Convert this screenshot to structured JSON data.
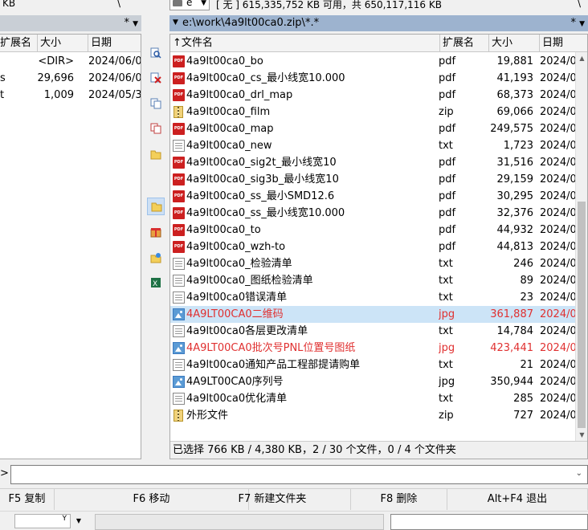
{
  "left_top": {
    "size_frag": "KB",
    "slash": "\\",
    "filter": "*",
    "filter_arrow": "▼"
  },
  "right_top": {
    "drive_letter": "e",
    "drive_arrow": "▼",
    "free_info": "[ 无 ]  615,335,752 KB 可用，共 650,117,116 KB",
    "slash": "\\",
    "path_arrow": "▼",
    "path": "e:\\work\\4a9lt00ca0.zip\\*.*",
    "filter": "*",
    "filter_arrow": "▼"
  },
  "left_panel": {
    "headers": {
      "ext": "扩展名",
      "size": "大小",
      "date": "日期"
    },
    "rows": [
      {
        "name": "",
        "ext": "",
        "size": "<DIR>",
        "date": "2024/06/0"
      },
      {
        "name": "s",
        "ext": "",
        "size": "29,696",
        "date": "2024/06/0"
      },
      {
        "name": "t",
        "ext": "",
        "size": "1,009",
        "date": "2024/05/3"
      }
    ]
  },
  "right_panel": {
    "headers": {
      "name": "↑文件名",
      "ext": "扩展名",
      "size": "大小",
      "date": "日期"
    },
    "rows": [
      {
        "icon": "pdf",
        "name": "4a9lt00ca0_bo",
        "ext": "pdf",
        "size": "19,881",
        "date": "2024/0",
        "red": false,
        "selected": false
      },
      {
        "icon": "pdf",
        "name": "4a9lt00ca0_cs_最小线宽10.000",
        "ext": "pdf",
        "size": "41,193",
        "date": "2024/0",
        "red": false,
        "selected": false
      },
      {
        "icon": "pdf",
        "name": "4a9lt00ca0_drl_map",
        "ext": "pdf",
        "size": "68,373",
        "date": "2024/0",
        "red": false,
        "selected": false
      },
      {
        "icon": "zip",
        "name": "4a9lt00ca0_film",
        "ext": "zip",
        "size": "69,066",
        "date": "2024/0",
        "red": false,
        "selected": false
      },
      {
        "icon": "pdf",
        "name": "4a9lt00ca0_map",
        "ext": "pdf",
        "size": "249,575",
        "date": "2024/0",
        "red": false,
        "selected": false
      },
      {
        "icon": "txt",
        "name": "4a9lt00ca0_new",
        "ext": "txt",
        "size": "1,723",
        "date": "2024/0",
        "red": false,
        "selected": false
      },
      {
        "icon": "pdf",
        "name": "4a9lt00ca0_sig2t_最小线宽10",
        "ext": "pdf",
        "size": "31,516",
        "date": "2024/0",
        "red": false,
        "selected": false
      },
      {
        "icon": "pdf",
        "name": "4a9lt00ca0_sig3b_最小线宽10",
        "ext": "pdf",
        "size": "29,159",
        "date": "2024/0",
        "red": false,
        "selected": false
      },
      {
        "icon": "pdf",
        "name": "4a9lt00ca0_ss_最小SMD12.6",
        "ext": "pdf",
        "size": "30,295",
        "date": "2024/0",
        "red": false,
        "selected": false
      },
      {
        "icon": "pdf",
        "name": "4a9lt00ca0_ss_最小线宽10.000",
        "ext": "pdf",
        "size": "32,376",
        "date": "2024/0",
        "red": false,
        "selected": false
      },
      {
        "icon": "pdf",
        "name": "4a9lt00ca0_to",
        "ext": "pdf",
        "size": "44,932",
        "date": "2024/0",
        "red": false,
        "selected": false
      },
      {
        "icon": "pdf",
        "name": "4a9lt00ca0_wzh-to",
        "ext": "pdf",
        "size": "44,813",
        "date": "2024/0",
        "red": false,
        "selected": false
      },
      {
        "icon": "txt",
        "name": "4a9lt00ca0_检验清单",
        "ext": "txt",
        "size": "246",
        "date": "2024/0",
        "red": false,
        "selected": false
      },
      {
        "icon": "txt",
        "name": "4a9lt00ca0_图纸检验清单",
        "ext": "txt",
        "size": "89",
        "date": "2024/0",
        "red": false,
        "selected": false
      },
      {
        "icon": "txt",
        "name": "4a9lt00ca0错误清单",
        "ext": "txt",
        "size": "23",
        "date": "2024/0",
        "red": false,
        "selected": false
      },
      {
        "icon": "jpg",
        "name": "4A9LT00CA0二维码",
        "ext": "jpg",
        "size": "361,887",
        "date": "2024/0",
        "red": true,
        "selected": true
      },
      {
        "icon": "txt",
        "name": "4a9lt00ca0各层更改清单",
        "ext": "txt",
        "size": "14,784",
        "date": "2024/0",
        "red": false,
        "selected": false
      },
      {
        "icon": "jpg",
        "name": "4A9LT00CA0批次号PNL位置号图纸",
        "ext": "jpg",
        "size": "423,441",
        "date": "2024/0",
        "red": true,
        "selected": false
      },
      {
        "icon": "txt",
        "name": "4a9lt00ca0通知产品工程部提请购单",
        "ext": "txt",
        "size": "21",
        "date": "2024/0",
        "red": false,
        "selected": false
      },
      {
        "icon": "jpg",
        "name": "4A9LT00CA0序列号",
        "ext": "jpg",
        "size": "350,944",
        "date": "2024/0",
        "red": false,
        "selected": false
      },
      {
        "icon": "txt",
        "name": "4a9lt00ca0优化清单",
        "ext": "txt",
        "size": "285",
        "date": "2024/0",
        "red": false,
        "selected": false
      },
      {
        "icon": "zip",
        "name": "外形文件",
        "ext": "zip",
        "size": "727",
        "date": "2024/0",
        "red": false,
        "selected": false
      }
    ],
    "status": "已选择 766 KB / 4,380 KB，2 / 30 个文件，0 / 4 个文件夹"
  },
  "toolbar_icons": [
    "find-icon",
    "delete-icon",
    "copy-icon",
    "move-icon",
    "folder-icon",
    "folder-icon",
    "pack-icon",
    "new-folder-icon",
    "excel-icon"
  ],
  "command": {
    "prompt": ">",
    "arrow": "⌄"
  },
  "fkeys": [
    {
      "label": "F5 复制"
    },
    {
      "label": "F6 移动"
    },
    {
      "label": "F7 新建文件夹"
    },
    {
      "label": "F8 删除"
    },
    {
      "label": "Alt+F4 退出"
    }
  ],
  "bottom": {
    "seg_text": "Y",
    "seg_arrow": "▼"
  },
  "colors": {
    "selected_bg": "#cce4f7",
    "red_text": "#e03030",
    "path_active_bg": "#9db3cf"
  }
}
